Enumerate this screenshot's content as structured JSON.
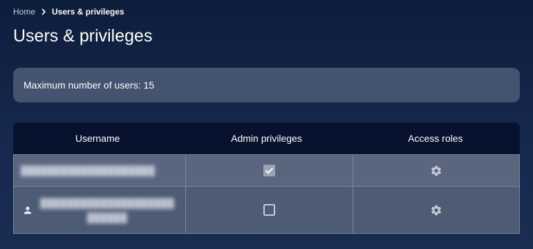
{
  "breadcrumb": {
    "home": "Home",
    "current": "Users & privileges"
  },
  "page": {
    "title": "Users & privileges"
  },
  "info": {
    "max_users_text": "Maximum number of users: 15"
  },
  "table": {
    "columns": [
      "Username",
      "Admin privileges",
      "Access roles"
    ],
    "rows": [
      {
        "username": "████████████████████",
        "admin": true,
        "has_user_icon": false
      },
      {
        "username": "████████████████████",
        "username_line2": "██████",
        "admin": false,
        "has_user_icon": true
      }
    ]
  },
  "icons": {
    "breadcrumb_separator": "chevron-right-icon",
    "admin_checkbox": "checkbox-icon",
    "access_roles": "gear-icon",
    "user": "person-icon"
  },
  "colors": {
    "background": "#0d1d3c",
    "info_box": "#44536f",
    "table_header": "#07122e",
    "row_1": "#59667e",
    "row_2": "#4e5b74"
  }
}
